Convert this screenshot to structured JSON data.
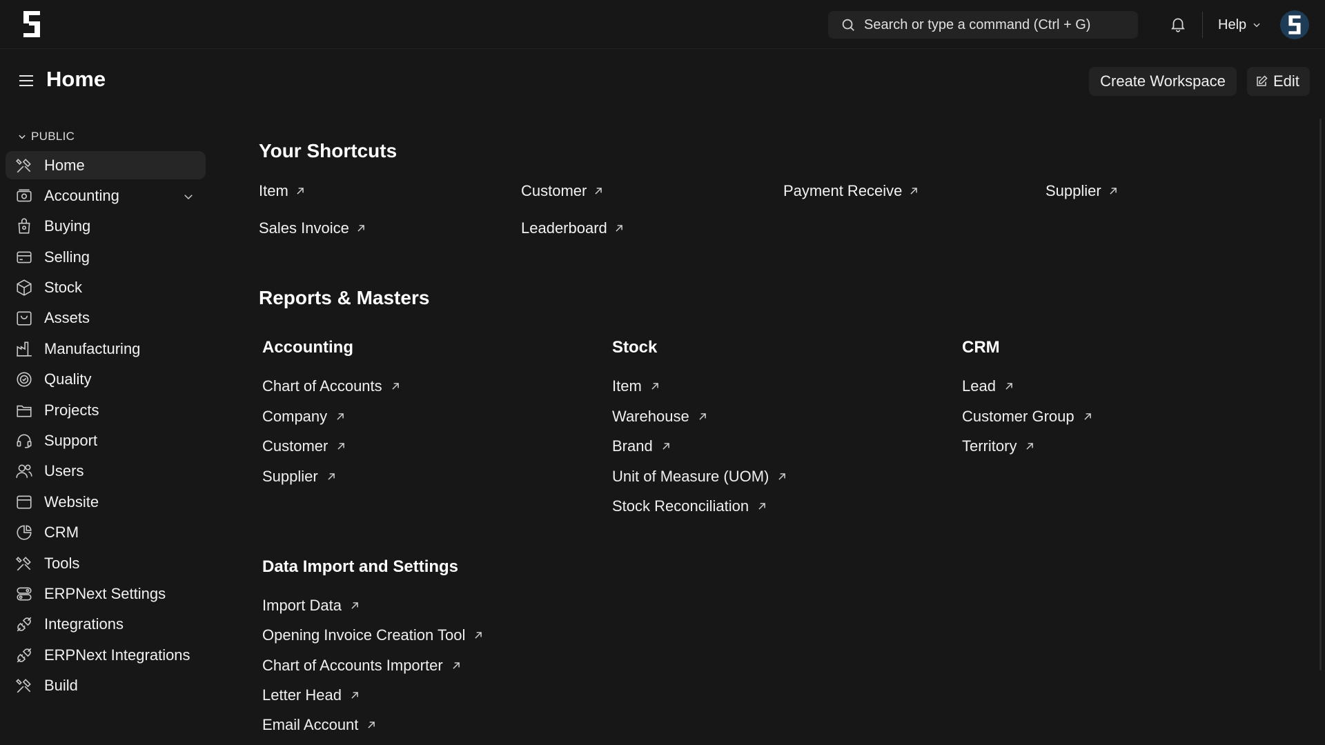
{
  "navbar": {
    "search_placeholder": "Search or type a command (Ctrl + G)",
    "help_label": "Help"
  },
  "header": {
    "title": "Home",
    "create_workspace_label": "Create Workspace",
    "edit_label": "Edit"
  },
  "sidebar": {
    "section_label": "PUBLIC",
    "items": [
      {
        "label": "Home",
        "icon": "tools-icon",
        "active": true
      },
      {
        "label": "Accounting",
        "icon": "accounting-icon",
        "expandable": true
      },
      {
        "label": "Buying",
        "icon": "buying-icon"
      },
      {
        "label": "Selling",
        "icon": "selling-icon"
      },
      {
        "label": "Stock",
        "icon": "stock-icon"
      },
      {
        "label": "Assets",
        "icon": "assets-icon"
      },
      {
        "label": "Manufacturing",
        "icon": "manufacturing-icon"
      },
      {
        "label": "Quality",
        "icon": "quality-icon"
      },
      {
        "label": "Projects",
        "icon": "projects-icon"
      },
      {
        "label": "Support",
        "icon": "support-icon"
      },
      {
        "label": "Users",
        "icon": "users-icon"
      },
      {
        "label": "Website",
        "icon": "website-icon"
      },
      {
        "label": "CRM",
        "icon": "crm-icon"
      },
      {
        "label": "Tools",
        "icon": "tools-icon"
      },
      {
        "label": "ERPNext Settings",
        "icon": "settings-icon"
      },
      {
        "label": "Integrations",
        "icon": "integrations-icon"
      },
      {
        "label": "ERPNext Integrations",
        "icon": "integrations-icon"
      },
      {
        "label": "Build",
        "icon": "tools-icon"
      }
    ]
  },
  "shortcuts": {
    "title": "Your Shortcuts",
    "items": [
      "Item",
      "Customer",
      "Payment Receive",
      "Supplier",
      "Sales Invoice",
      "Leaderboard"
    ]
  },
  "reports": {
    "title": "Reports & Masters",
    "cards": [
      {
        "title": "Accounting",
        "links": [
          "Chart of Accounts",
          "Company",
          "Customer",
          "Supplier"
        ]
      },
      {
        "title": "Stock",
        "links": [
          "Item",
          "Warehouse",
          "Brand",
          "Unit of Measure (UOM)",
          "Stock Reconciliation"
        ]
      },
      {
        "title": "CRM",
        "links": [
          "Lead",
          "Customer Group",
          "Territory"
        ]
      },
      {
        "title": "Data Import and Settings",
        "links": [
          "Import Data",
          "Opening Invoice Creation Tool",
          "Chart of Accounts Importer",
          "Letter Head",
          "Email Account"
        ]
      }
    ]
  },
  "colors": {
    "background": "#171717",
    "surface": "#232323",
    "active_item": "#262626",
    "avatar": "#1f3c57",
    "text": "#f2f2f2"
  }
}
